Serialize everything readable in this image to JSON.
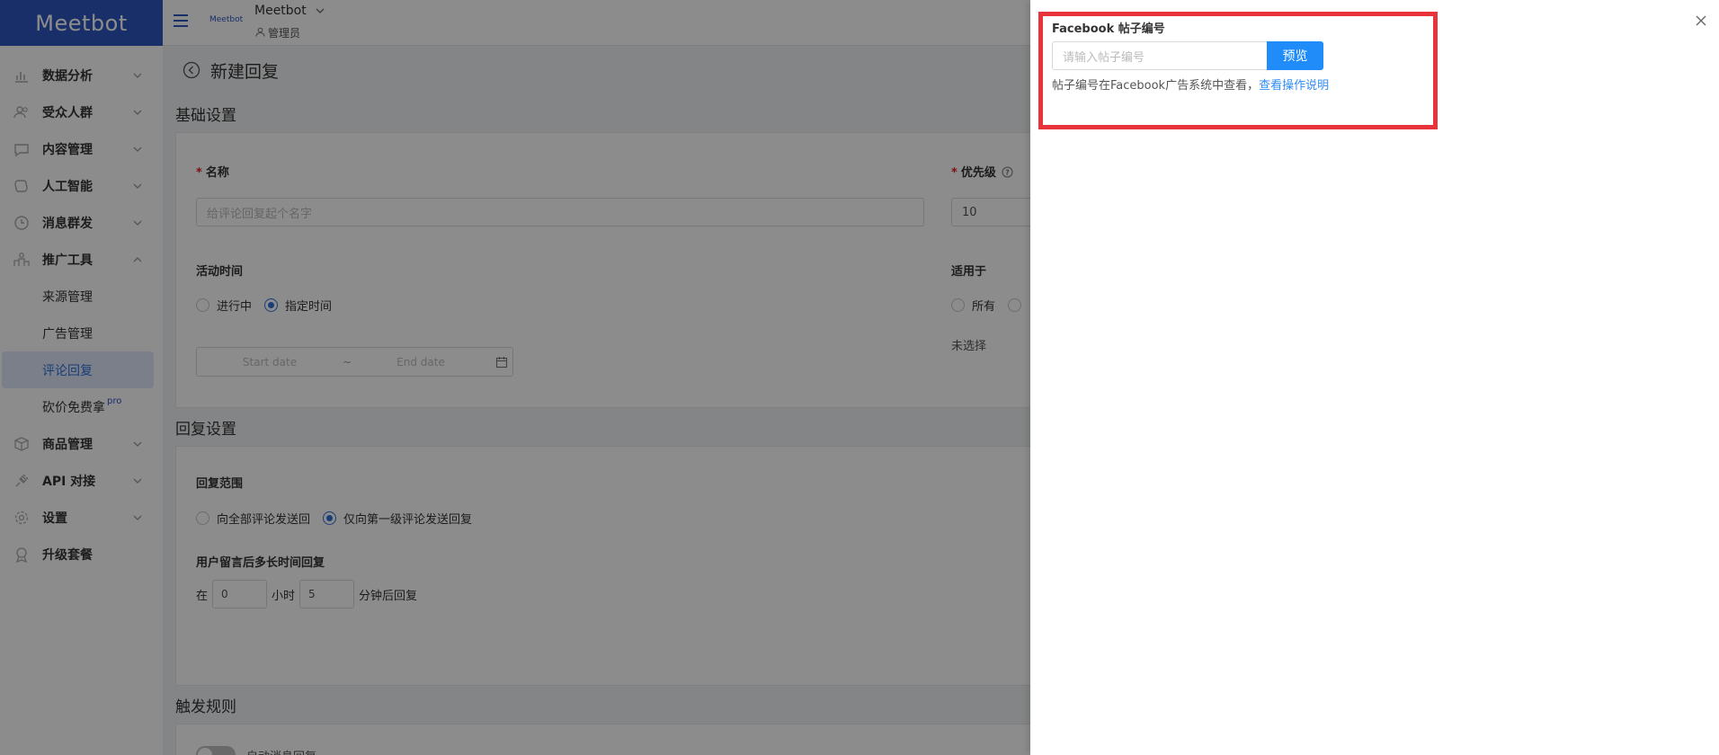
{
  "sidebar": {
    "logo": "Meetbot",
    "items": [
      {
        "label": "数据分析",
        "icon": "bar-chart-icon"
      },
      {
        "label": "受众人群",
        "icon": "users-icon"
      },
      {
        "label": "内容管理",
        "icon": "chat-icon"
      },
      {
        "label": "人工智能",
        "icon": "brain-icon"
      },
      {
        "label": "消息群发",
        "icon": "clock-icon"
      },
      {
        "label": "推广工具",
        "icon": "podium-icon"
      }
    ],
    "sub_items": [
      {
        "label": "来源管理"
      },
      {
        "label": "广告管理"
      },
      {
        "label": "评论回复",
        "active": true
      },
      {
        "label": "砍价免费拿",
        "tag": "pro"
      }
    ],
    "items_bottom": [
      {
        "label": "商品管理",
        "icon": "box-icon"
      },
      {
        "label": "API 对接",
        "icon": "plug-icon"
      },
      {
        "label": "设置",
        "icon": "gear-icon"
      },
      {
        "label": "升级套餐",
        "icon": "badge-icon"
      }
    ]
  },
  "header": {
    "mini_logo": "Meetbot",
    "workspace_name": "Meetbot",
    "role": "管理员"
  },
  "page": {
    "title": "新建回复",
    "section_basic": "基础设置",
    "name_label": "名称",
    "name_placeholder": "给评论回复起个名字",
    "priority_label": "优先级",
    "priority_value": "10",
    "activity_time_label": "活动时间",
    "radio_ongoing": "进行中",
    "radio_specified": "指定时间",
    "date_start_placeholder": "Start date",
    "date_sep": "~",
    "date_end_placeholder": "End date",
    "applies_to_label": "适用于",
    "applies_all": "所有",
    "not_selected": "未选择",
    "section_reply": "回复设置",
    "reply_scope_label": "回复范围",
    "scope_all": "向全部评论发送回",
    "scope_first": "仅向第一级评论发送回复",
    "delay_label": "用户留言后多长时间回复",
    "delay_prefix": "在",
    "delay_hours": "0",
    "delay_hours_unit": "小时",
    "delay_minutes": "5",
    "delay_minutes_unit": "分钟后回复",
    "section_trigger": "触发规则",
    "trigger_toggle_label": "自动消息回复"
  },
  "drawer": {
    "fb_label": "Facebook 帖子编号",
    "fb_placeholder": "请输入帖子编号",
    "preview_button": "预览",
    "hint_text": "帖子编号在Facebook广告系统中查看，",
    "hint_link": "查看操作说明",
    "highlight_color": "#e8333a",
    "accent_color": "#1f8cfa"
  }
}
